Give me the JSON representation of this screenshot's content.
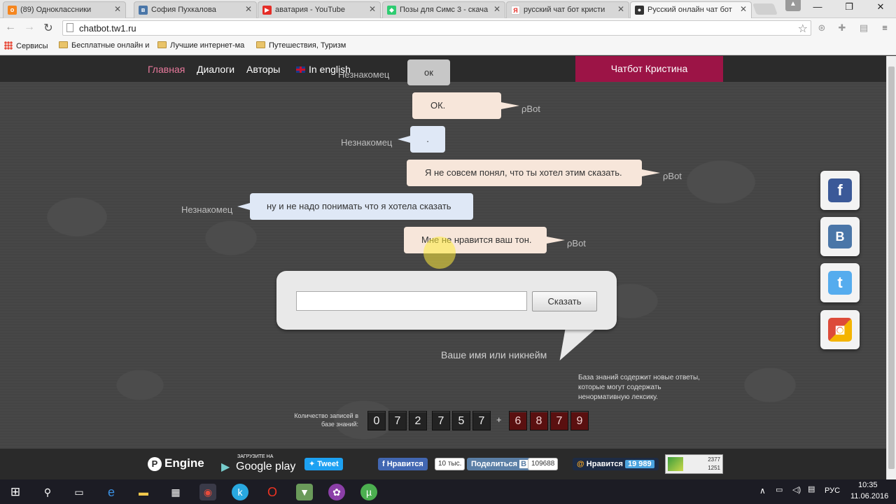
{
  "browser": {
    "tabs": [
      {
        "label": "(89) Одноклассники",
        "icon": "odnoklassniki-icon",
        "color": "#f5861f",
        "glyph": "о"
      },
      {
        "label": "София Пухкалова",
        "icon": "vk-icon",
        "color": "#4a76a8",
        "glyph": "в"
      },
      {
        "label": "аватария - YouTube",
        "icon": "youtube-icon",
        "color": "#e52d27",
        "glyph": "▶"
      },
      {
        "label": "Позы для Симс 3 - скача",
        "icon": "sims-icon",
        "color": "#2ecc71",
        "glyph": "◆"
      },
      {
        "label": "русский чат бот кристи",
        "icon": "yandex-icon",
        "color": "#fff",
        "glyph": "Я"
      },
      {
        "label": "Русский онлайн чат бот",
        "icon": "chatbot-icon",
        "color": "#333",
        "glyph": "●"
      }
    ],
    "url": "chatbot.tw1.ru",
    "bookmarks": [
      {
        "label": "Сервисы",
        "type": "apps"
      },
      {
        "label": "Бесплатные онлайн и",
        "type": "folder"
      },
      {
        "label": "Лучшие интернет-ма",
        "type": "folder"
      },
      {
        "label": "Путешествия, Туризм",
        "type": "folder"
      }
    ]
  },
  "nav": {
    "home": "Главная",
    "dialogs": "Диалоги",
    "authors": "Авторы",
    "english": "In english",
    "brand": "Чатбот Кристина"
  },
  "chat": {
    "stranger": "Незнакомец",
    "bot": "ρBot",
    "messages": [
      {
        "from": "stranger",
        "text": "ок"
      },
      {
        "from": "bot",
        "text": "ОК."
      },
      {
        "from": "stranger",
        "text": "."
      },
      {
        "from": "bot",
        "text": "Я не совсем понял, что ты хотел этим сказать."
      },
      {
        "from": "stranger",
        "text": "ну и не надо понимать что я хотела сказать"
      },
      {
        "from": "bot",
        "text": "Мне не нравится ваш тон."
      }
    ]
  },
  "input": {
    "value": "",
    "button": "Сказать",
    "nick_prompt": "Ваше имя или никнейм"
  },
  "knowledge": {
    "note": "База знаний содержит новые ответы, которые могут содержать ненормативную лексику.",
    "counter_label": "Количество записей в базе знаний:",
    "digits": [
      "0",
      "7",
      "2",
      "7",
      "5",
      "7"
    ],
    "plus": "+",
    "new_digits": [
      "6",
      "8",
      "7",
      "9"
    ]
  },
  "social": [
    {
      "name": "facebook-share",
      "glyph": "f",
      "color": "#3b5998"
    },
    {
      "name": "vk-share",
      "glyph": "B",
      "color": "#4a76a8"
    },
    {
      "name": "twitter-share",
      "glyph": "t",
      "color": "#55acee"
    },
    {
      "name": "chrome-share",
      "glyph": "◙",
      "color": "#dd4b39"
    }
  ],
  "footer": {
    "engine": "Engine",
    "google_small": "ЗАГРУЗИТЕ НА",
    "google": "Google play",
    "tweet": "Tweet",
    "fb_like": "Нравится",
    "fb_count": "10 тыс.",
    "vk_share": "Поделиться",
    "vk_count": "109688",
    "ok_like": "Нравится",
    "ok_count": "19 989",
    "stats_top": "2377",
    "stats_bottom": "1251"
  },
  "taskbar": {
    "lang": "РУС",
    "time": "10:35",
    "date": "11.06.2016"
  }
}
